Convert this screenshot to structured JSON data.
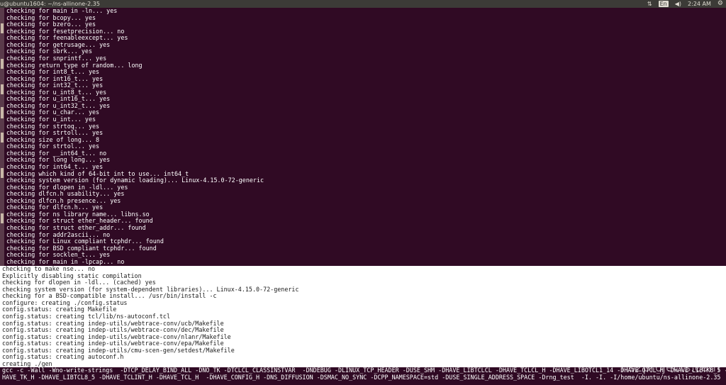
{
  "window": {
    "title": "u@ubuntu1604: ~/ns-allinone-2.35"
  },
  "indicators": {
    "keyboard_lang": "En",
    "time": "2:24 AM"
  },
  "terminal": {
    "lines_upper": [
      "checking for main in -ln... yes",
      "checking for bcopy... yes",
      "checking for bzero... yes",
      "checking for fesetprecision... no",
      "checking for feenableexcept... yes",
      "checking for getrusage... yes",
      "checking for sbrk... yes",
      "checking for snprintf... yes",
      "checking return type of random... long",
      "checking for int8_t... yes",
      "checking for int16_t... yes",
      "checking for int32_t... yes",
      "checking for u_int8_t... yes",
      "checking for u_int16_t... yes",
      "checking for u_int32_t... yes",
      "checking for u_char... yes",
      "checking for u_int... yes",
      "checking for strtoq... yes",
      "checking for strtoll... yes",
      "checking size of long... 8",
      "checking for strtol... yes",
      "checking for __int64_t... no",
      "checking for long long... yes",
      "checking for int64_t... yes",
      "checking which kind of 64-bit int to use... int64_t",
      "checking system version (for dynamic loading)... Linux-4.15.0-72-generic",
      "checking for dlopen in -ldl... yes",
      "checking dlfcn.h usability... yes",
      "checking dlfcn.h presence... yes",
      "checking for dlfcn.h... yes",
      "checking for ns library name... libns.so",
      "checking for struct ether_header... found",
      "checking for struct ether_addr... found",
      "checking for addr2ascii... no",
      "checking for Linux compliant tcphdr... found",
      "checking for BSD compliant tcphdr... found",
      "checking for socklen_t... yes",
      "checking for main in -lpcap... no"
    ],
    "lines_lower": [
      "checking to make nse... no",
      "Explicitly disabling static compilation",
      "checking for dlopen in -ldl... (cached) yes",
      "checking system version (for system-dependent libraries)... Linux-4.15.0-72-generic",
      "checking for a BSD-compatible install... /usr/bin/install -c",
      "configure: creating ./config.status",
      "config.status: creating Makefile",
      "config.status: creating tcl/lib/ns-autoconf.tcl",
      "config.status: creating indep-utils/webtrace-conv/ucb/Makefile",
      "config.status: creating indep-utils/webtrace-conv/dec/Makefile",
      "config.status: creating indep-utils/webtrace-conv/nlanr/Makefile",
      "config.status: creating indep-utils/webtrace-conv/epa/Makefile",
      "config.status: creating indep-utils/cmu-scen-gen/setdest/Makefile",
      "config.status: creating autoconf.h",
      "creating ./gen"
    ],
    "lines_bottom": [
      "gcc -c -Wall -Wno-write-strings  -DTCP_DELAY_BIND_ALL -DNO_TK -DTCLCL_CLASSINSTVAR  -DNDEBUG -DLINUX_TCP_HEADER -DUSE_SHM -DHAVE_LIBTCLCL -DHAVE_TCLCL_H -DHAVE_LIBOTCL1_14 -DHAVE_OTCL_H -DHAVE_LIBTK8_5 -D",
      "HAVE_TK_H -DHAVE_LIBTCL8_5 -DHAVE_TCLINT_H -DHAVE_TCL_H  -DHAVE_CONFIG_H -DNS_DIFFUSION -DSMAC_NO_SYNC -DCPP_NAMESPACE=std -DUSE_SINGLE_ADDRESS_SPACE -Drng_test  -I. -I. -I/home/ubuntu/ns-allinone-2.35"
    ]
  },
  "watermark": {
    "text": "ns2projects.com"
  }
}
